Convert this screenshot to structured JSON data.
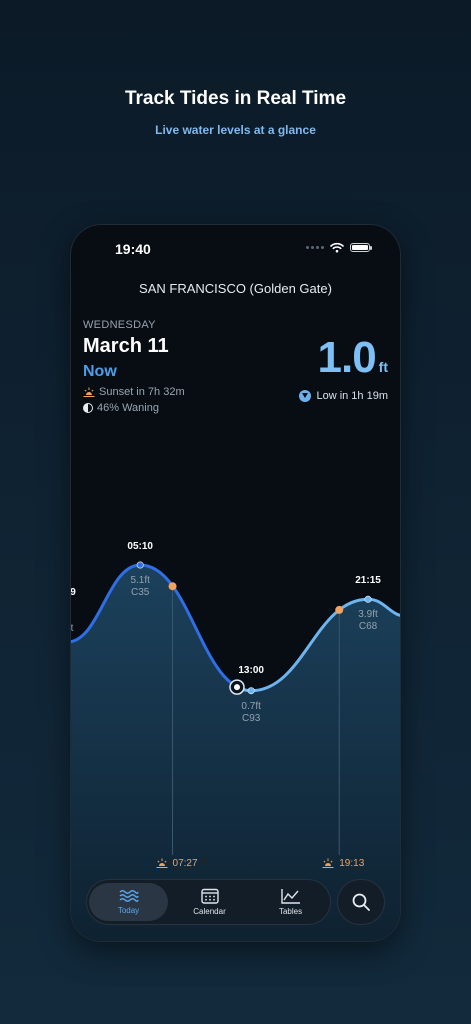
{
  "promo": {
    "headline": "Track Tides in Real Time",
    "subline": "Live water levels at a glance"
  },
  "status_bar": {
    "time": "19:40"
  },
  "location": "SAN FRANCISCO (Golden Gate)",
  "day": {
    "weekday": "WEDNESDAY",
    "date": "March 11",
    "now_label": "Now",
    "sunset_text": "Sunset in 7h 32m",
    "moon_text": "46% Waning"
  },
  "current": {
    "level": "1.0",
    "unit": "ft",
    "next_tide": "Low in 1h 19m"
  },
  "tide_chart": {
    "type": "line",
    "y_range_ft": [
      -1.2,
      6.5
    ],
    "points": [
      {
        "time": "00:00",
        "hours": 0.0,
        "ft": 2.4
      },
      {
        "time": "05:10",
        "hours": 5.17,
        "ft": 5.1
      },
      {
        "time": "13:00",
        "hours": 13.0,
        "ft": 0.7
      },
      {
        "time": "21:15",
        "hours": 21.25,
        "ft": 3.9
      },
      {
        "time": "24:00",
        "hours": 24.0,
        "ft": 3.3
      }
    ],
    "extremes": [
      {
        "time": "9",
        "height": "",
        "coef": "",
        "label_side": "above",
        "clip": true
      },
      {
        "time": "05:10",
        "height": "5.1ft",
        "coef": "C35"
      },
      {
        "time": "13:00",
        "height": "0.7ft",
        "coef": "C93"
      },
      {
        "time": "21:15",
        "height": "3.9ft",
        "coef": "C68"
      }
    ],
    "left_edge_fragment": "t",
    "current_marker_hours": 12.0,
    "sunrise": "07:27",
    "sunset": "19:13",
    "colors": {
      "past_line": "#2f6fe6",
      "future_line": "#6db5f0",
      "sun_marker": "#f0a25e",
      "fill": "#1d4460"
    }
  },
  "tabs": [
    {
      "label": "Today",
      "icon": "waves-icon",
      "active": true
    },
    {
      "label": "Calendar",
      "icon": "calendar-icon",
      "active": false
    },
    {
      "label": "Tables",
      "icon": "chart-icon",
      "active": false
    }
  ],
  "search": {
    "icon": "search-icon"
  }
}
